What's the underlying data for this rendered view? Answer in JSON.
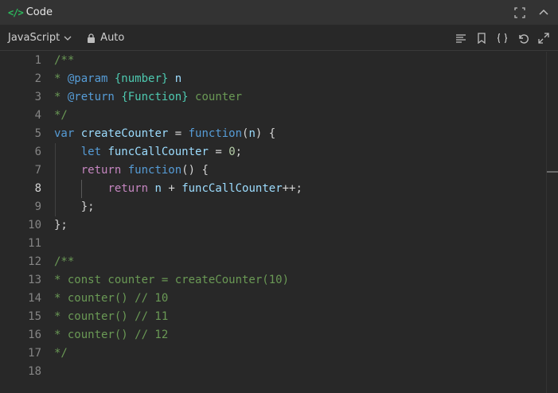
{
  "window": {
    "title": "Code",
    "title_icon": "code-icon"
  },
  "toolbar": {
    "language": "JavaScript",
    "indent_mode": "Auto"
  },
  "editor": {
    "active_line": 8,
    "lines": [
      {
        "n": "1",
        "tokens": [
          [
            "c",
            "/**"
          ]
        ]
      },
      {
        "n": "2",
        "tokens": [
          [
            "c",
            "* "
          ],
          [
            "tag",
            "@param"
          ],
          [
            "c",
            " "
          ],
          [
            "type",
            "{number}"
          ],
          [
            "c",
            " "
          ],
          [
            "var",
            "n"
          ]
        ]
      },
      {
        "n": "3",
        "tokens": [
          [
            "c",
            "* "
          ],
          [
            "tag",
            "@return"
          ],
          [
            "c",
            " "
          ],
          [
            "type",
            "{Function}"
          ],
          [
            "c",
            " counter"
          ]
        ]
      },
      {
        "n": "4",
        "tokens": [
          [
            "c",
            "*/"
          ]
        ]
      },
      {
        "n": "5",
        "tokens": [
          [
            "kw",
            "var"
          ],
          [
            "p",
            " "
          ],
          [
            "var",
            "createCounter"
          ],
          [
            "p",
            " = "
          ],
          [
            "kw",
            "function"
          ],
          [
            "p",
            "("
          ],
          [
            "var",
            "n"
          ],
          [
            "p",
            ") {"
          ]
        ]
      },
      {
        "n": "6",
        "tokens": [
          [
            "p",
            "    "
          ],
          [
            "kw",
            "let"
          ],
          [
            "p",
            " "
          ],
          [
            "var",
            "funcCallCounter"
          ],
          [
            "p",
            " = "
          ],
          [
            "num",
            "0"
          ],
          [
            "p",
            ";"
          ]
        ]
      },
      {
        "n": "7",
        "tokens": [
          [
            "p",
            "    "
          ],
          [
            "ctrl",
            "return"
          ],
          [
            "p",
            " "
          ],
          [
            "kw",
            "function"
          ],
          [
            "p",
            "() {"
          ]
        ]
      },
      {
        "n": "8",
        "tokens": [
          [
            "p",
            "        "
          ],
          [
            "ctrl",
            "return"
          ],
          [
            "p",
            " "
          ],
          [
            "var",
            "n"
          ],
          [
            "p",
            " + "
          ],
          [
            "var",
            "funcCallCounter"
          ],
          [
            "p",
            "++;"
          ]
        ]
      },
      {
        "n": "9",
        "tokens": [
          [
            "p",
            "    };"
          ]
        ]
      },
      {
        "n": "10",
        "tokens": [
          [
            "p",
            "};"
          ]
        ]
      },
      {
        "n": "11",
        "tokens": []
      },
      {
        "n": "12",
        "tokens": [
          [
            "c",
            "/**"
          ]
        ]
      },
      {
        "n": "13",
        "tokens": [
          [
            "c",
            "* const counter = createCounter(10)"
          ]
        ]
      },
      {
        "n": "14",
        "tokens": [
          [
            "c",
            "* counter() // 10"
          ]
        ]
      },
      {
        "n": "15",
        "tokens": [
          [
            "c",
            "* counter() // 11"
          ]
        ]
      },
      {
        "n": "16",
        "tokens": [
          [
            "c",
            "* counter() // 12"
          ]
        ]
      },
      {
        "n": "17",
        "tokens": [
          [
            "c",
            "*/"
          ]
        ]
      },
      {
        "n": "18",
        "tokens": []
      }
    ]
  },
  "icons": {
    "fullscreen": "fullscreen-icon",
    "collapse": "chevron-up-icon",
    "format": "format-lines-icon",
    "bookmark": "bookmark-icon",
    "braces": "braces-icon",
    "reset": "undo-icon",
    "expand": "expand-icon",
    "lock": "lock-icon",
    "chevron": "chevron-down-icon"
  },
  "colors": {
    "accent": "#2cbb5d",
    "background": "#282828",
    "comment": "#6a9955",
    "keyword": "#569cd6",
    "control": "#c586c0",
    "variable": "#9cdcfe",
    "number": "#b5cea8",
    "type": "#4ec9b0"
  }
}
